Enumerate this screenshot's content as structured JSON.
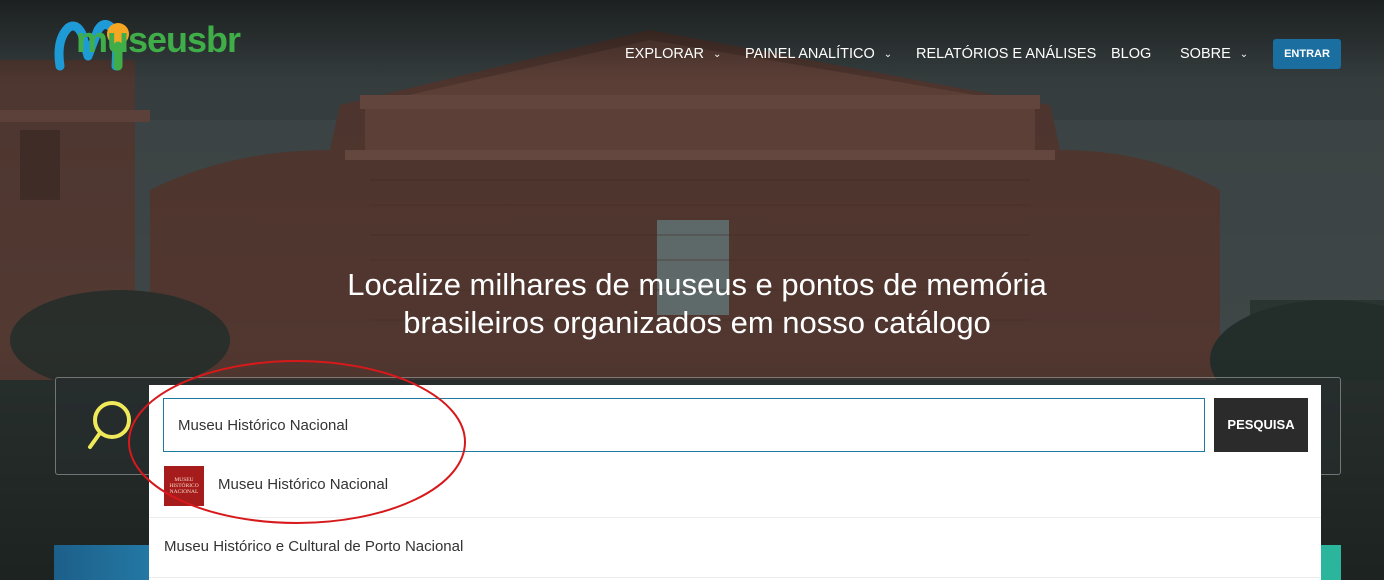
{
  "brand": {
    "logo_text": "museusbr",
    "colors": {
      "blue": "#1e9ad6",
      "orange": "#f5a623",
      "green": "#3fae49"
    }
  },
  "nav": {
    "items": [
      {
        "label": "EXPLORAR",
        "has_dropdown": true
      },
      {
        "label": "PAINEL ANALÍTICO",
        "has_dropdown": true
      },
      {
        "label": "RELATÓRIOS E ANÁLISES",
        "has_dropdown": false
      },
      {
        "label": "BLOG",
        "has_dropdown": false
      },
      {
        "label": "SOBRE",
        "has_dropdown": true
      }
    ],
    "chevron": "⌄",
    "login_label": "ENTRAR"
  },
  "hero": {
    "headline_line1": "Localize milhares de museus e pontos de memória",
    "headline_line2": "brasileiros organizados em nosso catálogo"
  },
  "search": {
    "icon": "search-icon",
    "value": "Museu Histórico Nacional",
    "button_label": "PESQUISA",
    "suggestions": [
      {
        "label": "Museu Histórico Nacional",
        "thumbnail_text": "MUSEU HISTÓRICO NACIONAL"
      },
      {
        "label": "Museu Histórico e Cultural de Porto Nacional"
      }
    ]
  },
  "colors": {
    "accent_blue": "#1a6fa0",
    "search_border": "#1e7aa0",
    "annotation_red": "#d7191c"
  }
}
